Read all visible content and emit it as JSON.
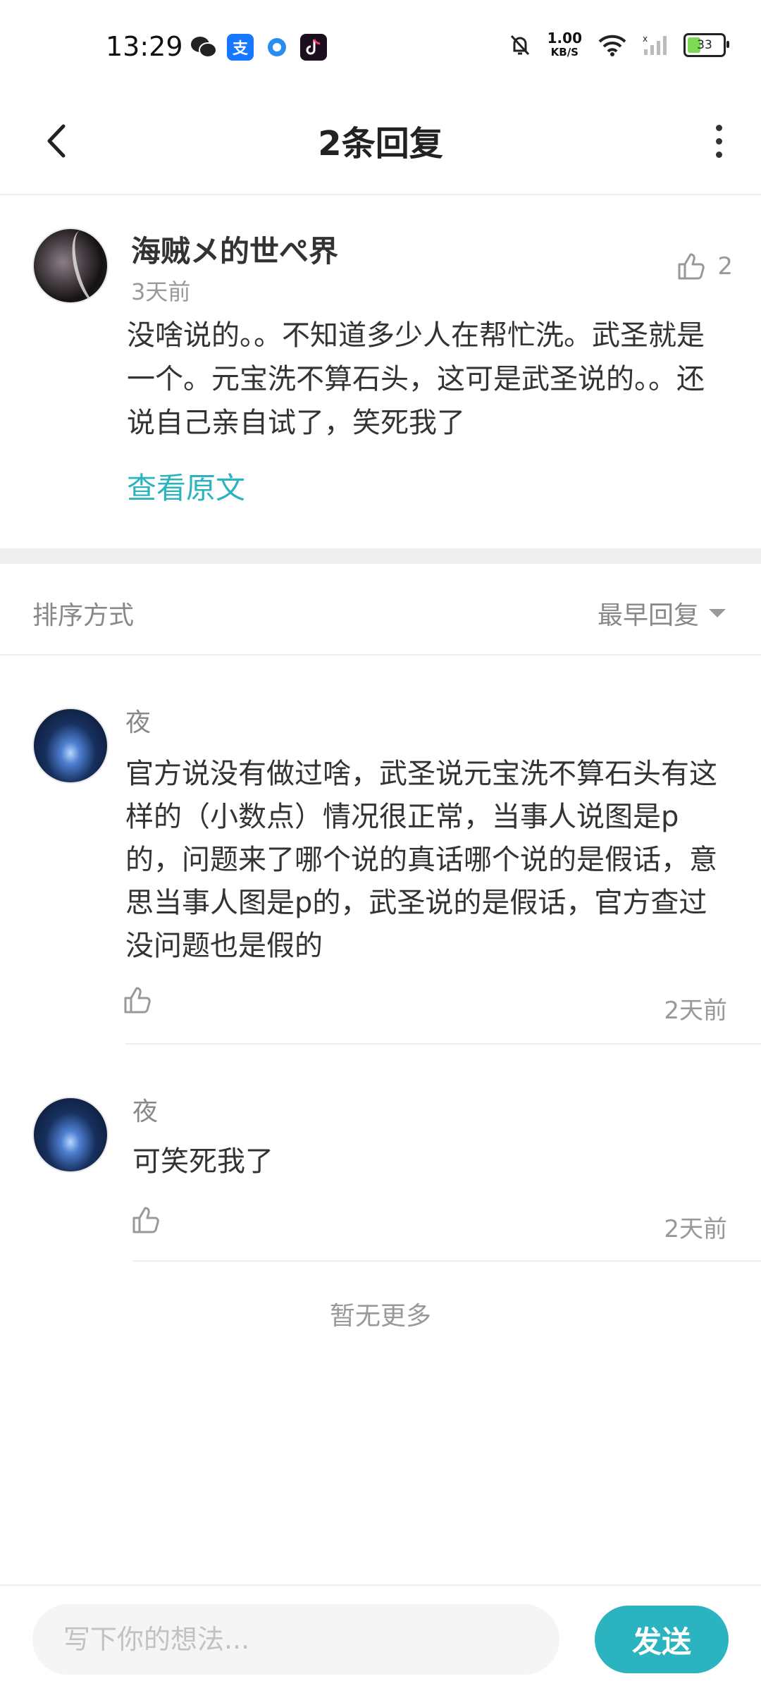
{
  "status_bar": {
    "time": "13:29",
    "net_speed_value": "1.00",
    "net_speed_unit": "KB/S",
    "battery": "33",
    "app_icons": [
      "wechat-icon",
      "alipay-icon",
      "browser-icon",
      "tiktok-icon"
    ]
  },
  "nav": {
    "title": "2条回复"
  },
  "main_comment": {
    "username": "海贼メ的世ぺ界",
    "time": "3天前",
    "likes": "2",
    "body": "没啥说的。。不知道多少人在帮忙洗。武圣就是一个。元宝洗不算石头，这可是武圣说的。。还说自己亲自试了，笑死我了",
    "view_original": "查看原文"
  },
  "sort": {
    "label": "排序方式",
    "selected": "最早回复"
  },
  "replies": [
    {
      "name": "夜",
      "body": "官方说没有做过啥，武圣说元宝洗不算石头有这样的（小数点）情况很正常，当事人说图是p的，问题来了哪个说的真话哪个说的是假话，意思当事人图是p的，武圣说的是假话，官方查过没问题也是假的",
      "time": "2天前"
    },
    {
      "name": "夜",
      "body": "可笑死我了",
      "time": "2天前"
    }
  ],
  "no_more": "暂无更多",
  "composer": {
    "placeholder": "写下你的想法...",
    "send_label": "发送"
  },
  "colors": {
    "accent": "#2bb4c0",
    "muted": "#999999"
  }
}
